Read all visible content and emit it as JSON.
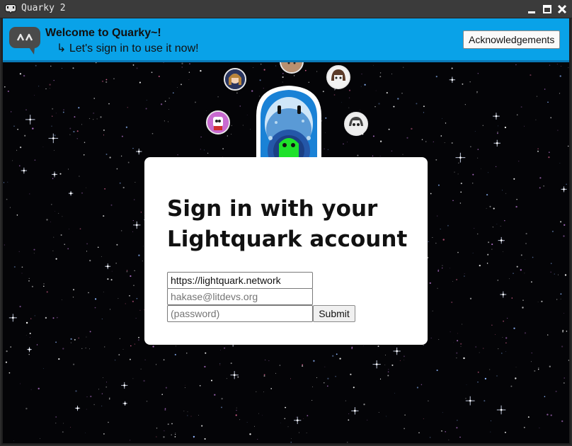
{
  "window": {
    "title": "Quarky 2",
    "buttons": [
      "minimize-icon",
      "maximize-icon",
      "close-icon"
    ]
  },
  "banner": {
    "title": "Welcome to Quarky~!",
    "subtitle": "↳ Let's sign in to use it now!",
    "ack_label": "Acknowledgements",
    "background_color": "#09a2e8"
  },
  "login": {
    "heading": "Sign in with your Lightquark account",
    "server_value": "https://lightquark.network",
    "email_placeholder": "hakase@litdevs.org",
    "password_placeholder": "(password)",
    "submit_label": "Submit"
  }
}
